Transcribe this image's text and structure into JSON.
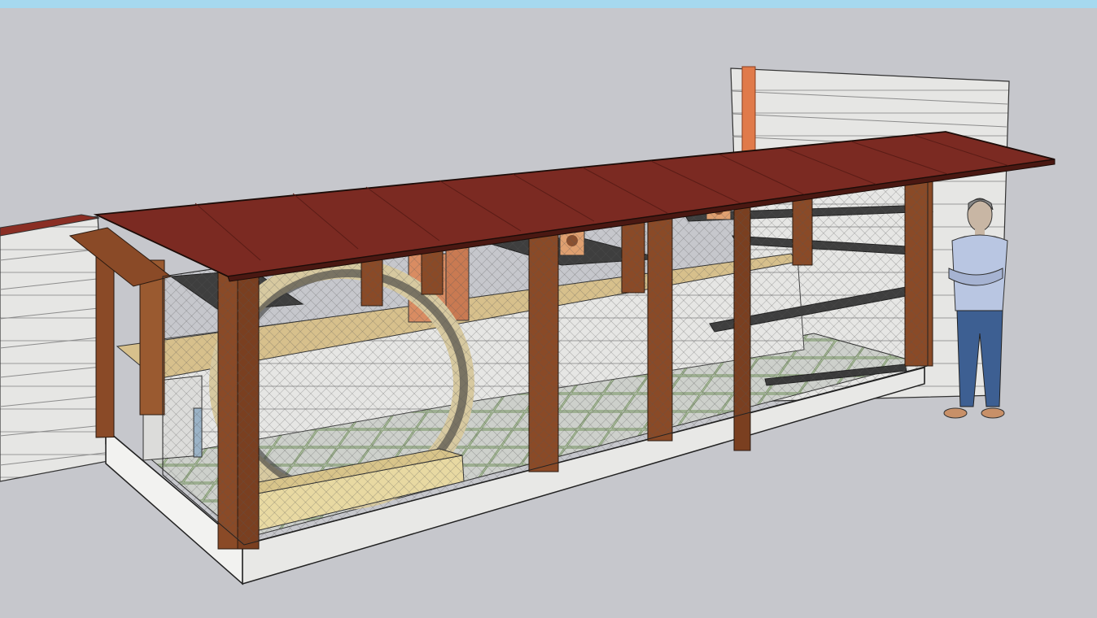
{
  "viewport": {
    "background": "#c6c7cc",
    "top_bar_color": "#a6d9ef"
  },
  "model": {
    "roof_color": "#7b2a22",
    "post_color": "#8a4a27",
    "wall_color": "#e4e4e2",
    "floor_color": "#c9cbc8",
    "wheel_color": "#d7c9a0",
    "vent_pipe_color": "#e07a4a",
    "shelf_color": "#4a4a4a"
  }
}
